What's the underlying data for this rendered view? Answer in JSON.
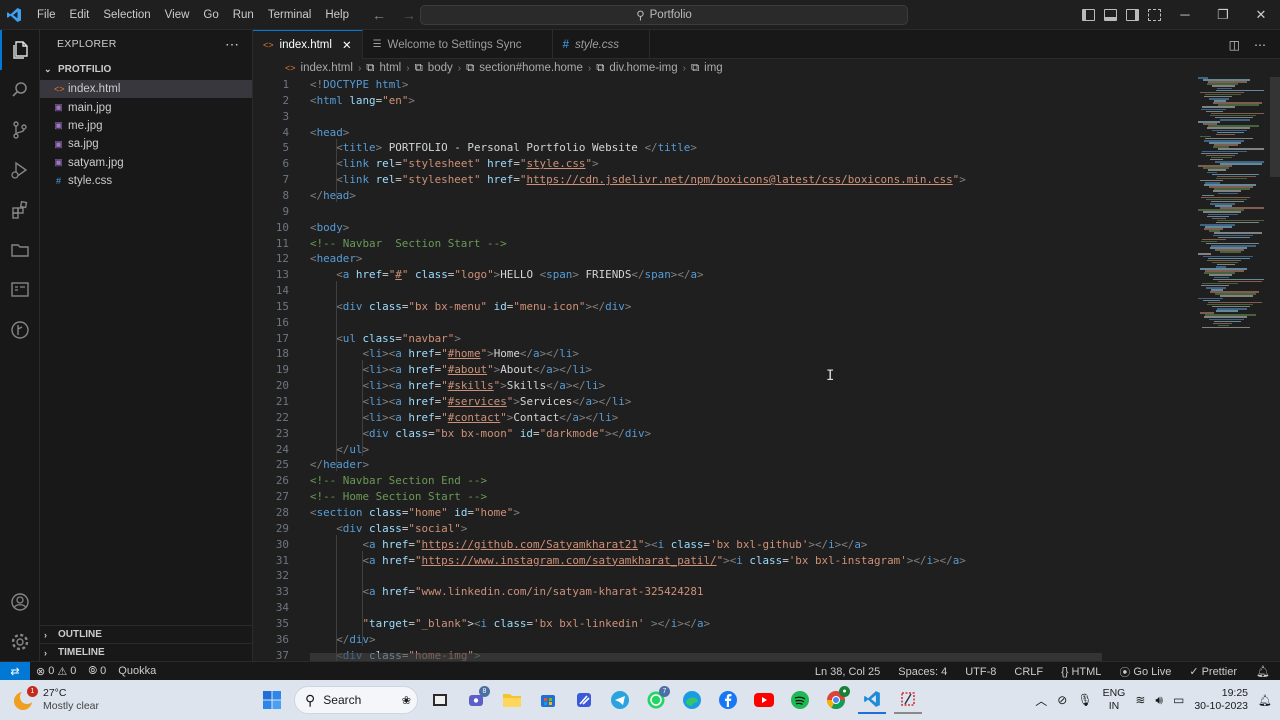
{
  "titlebar": {
    "menu": [
      "File",
      "Edit",
      "Selection",
      "View",
      "Go",
      "Run",
      "Terminal",
      "Help"
    ],
    "search_text": "Portfolio"
  },
  "sidebar": {
    "title": "EXPLORER",
    "folder": "PROTFILIO",
    "files": [
      {
        "name": "index.html",
        "icon": "html-file-icon"
      },
      {
        "name": "main.jpg",
        "icon": "image-file-icon"
      },
      {
        "name": "me.jpg",
        "icon": "image-file-icon"
      },
      {
        "name": "sa.jpg",
        "icon": "image-file-icon"
      },
      {
        "name": "satyam.jpg",
        "icon": "image-file-icon"
      },
      {
        "name": "style.css",
        "icon": "css-file-icon"
      }
    ],
    "outline": "OUTLINE",
    "timeline": "TIMELINE"
  },
  "tabs": [
    {
      "label": "index.html",
      "active": true
    },
    {
      "label": "Welcome to Settings Sync",
      "active": false
    },
    {
      "label": "style.css",
      "active": false
    }
  ],
  "breadcrumb": [
    "index.html",
    "html",
    "body",
    "section#home.home",
    "div.home-img",
    "img"
  ],
  "editor": {
    "line_numbers": [
      "1",
      "2",
      "3",
      "4",
      "5",
      "6",
      "7",
      "8",
      "9",
      "10",
      "11",
      "12",
      "13",
      "14",
      "15",
      "16",
      "17",
      "18",
      "19",
      "20",
      "21",
      "22",
      "23",
      "24",
      "25",
      "26",
      "27",
      "28",
      "29",
      "30",
      "31",
      "32",
      "33",
      "34",
      "35",
      "36",
      "37"
    ]
  },
  "statusbar": {
    "problems": "0",
    "warnings": "0",
    "ports": "0",
    "quokka": "Quokka",
    "position": "Ln 38, Col 25",
    "spaces": "Spaces: 4",
    "encoding": "UTF-8",
    "eol": "CRLF",
    "language": "HTML",
    "golive": "Go Live",
    "prettier": "Prettier"
  },
  "taskbar": {
    "temperature": "27°C",
    "weather": "Mostly clear",
    "search": "Search",
    "lang1": "ENG",
    "lang2": "IN",
    "time": "19:25",
    "date": "30-10-2023",
    "badge_meet": "8",
    "badge_whatsapp": "7",
    "badge_weather": "1"
  },
  "colors": {
    "accent": "#0078d4",
    "tag": "#569cd6",
    "attr": "#9cdcfe",
    "string": "#ce9178",
    "comment": "#6a9955"
  }
}
